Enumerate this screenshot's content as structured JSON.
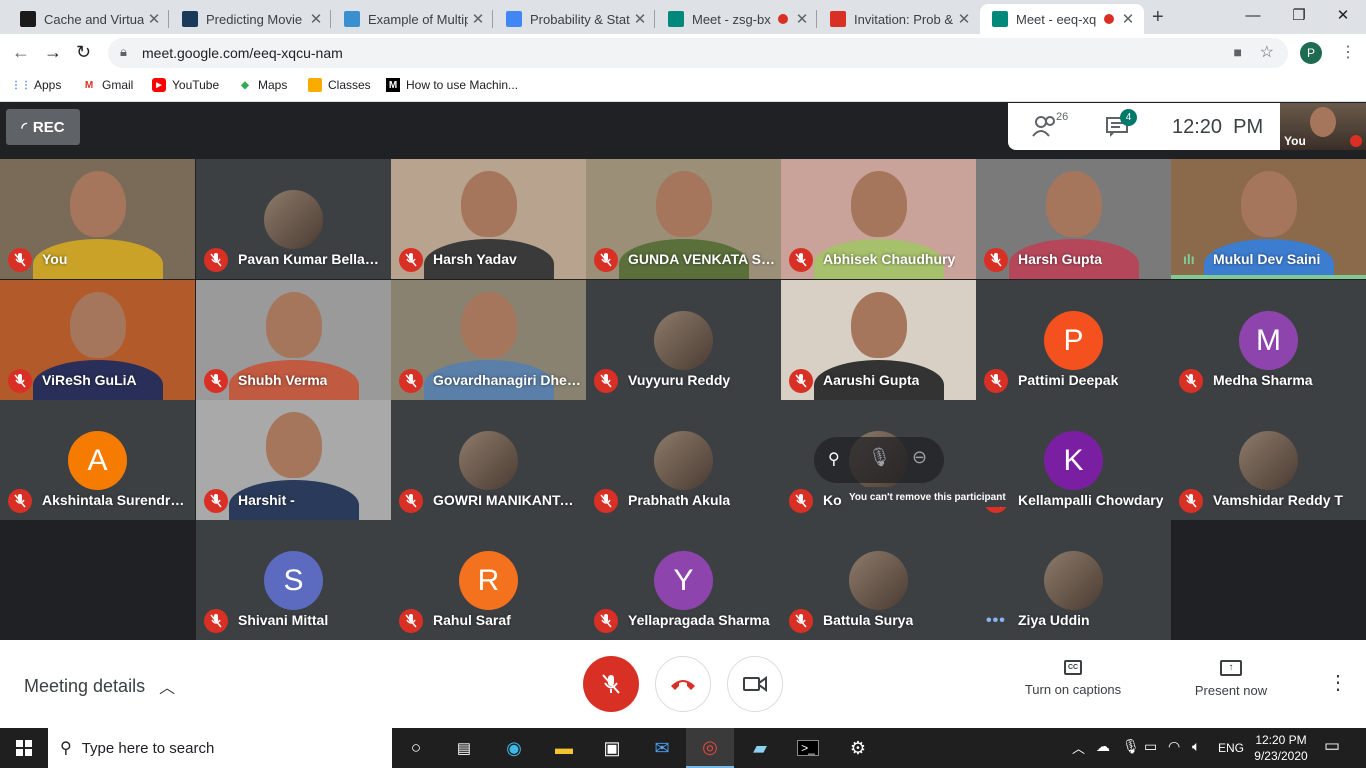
{
  "browser": {
    "tabs": [
      {
        "title": "Cache and Virtual",
        "icon": "doc-icon",
        "color": "#1a1a1a"
      },
      {
        "title": "Predicting Movie R",
        "icon": "tds-icon",
        "color": "#1a3a5c"
      },
      {
        "title": "Example of Multip",
        "icon": "fish-icon",
        "color": "#3a8fd1"
      },
      {
        "title": "Probability & Stati",
        "icon": "person-icon",
        "color": "#4285f4"
      },
      {
        "title": "Meet - zsg-bx",
        "icon": "meet-icon",
        "color": "#00897b"
      },
      {
        "title": "Invitation: Prob &",
        "icon": "gmail-icon",
        "color": "#d93025"
      },
      {
        "title": "Meet - eeq-xq",
        "icon": "meet-icon",
        "color": "#00897b"
      }
    ],
    "url": "meet.google.com/eeq-xqcu-nam",
    "profile_initial": "P",
    "bookmarks": [
      "Apps",
      "Gmail",
      "YouTube",
      "Maps",
      "Classes",
      "How to use Machin..."
    ]
  },
  "meet": {
    "rec_label": "REC",
    "participant_count": "26",
    "chat_badge": "4",
    "time": "12:20  PM",
    "self_label": "You",
    "tiles": [
      {
        "name": "You",
        "kind": "video",
        "bg": "#7a6a58",
        "shirt": "#c9a227"
      },
      {
        "name": "Pavan Kumar Bellamk...",
        "kind": "photo"
      },
      {
        "name": "Harsh Yadav",
        "kind": "video",
        "bg": "#b8a48e",
        "shirt": "#3a3a3a"
      },
      {
        "name": "GUNDA VENKATA SAI ...",
        "kind": "video",
        "bg": "#9c8f78",
        "shirt": "#5a6f3a"
      },
      {
        "name": "Abhisek Chaudhury",
        "kind": "video",
        "bg": "#c9a39a",
        "shirt": "#a7c06b"
      },
      {
        "name": "Harsh Gupta",
        "kind": "video",
        "bg": "#7a7a7a",
        "shirt": "#b5475b"
      },
      {
        "name": "Mukul Dev Saini",
        "kind": "video",
        "bg": "#8a6a4a",
        "shirt": "#3c7dd0",
        "speaking": true
      },
      {
        "name": "ViReSh GuLiA",
        "kind": "video",
        "bg": "#b35a2a",
        "shirt": "#2a2f5a"
      },
      {
        "name": "Shubh Verma",
        "kind": "video",
        "bg": "#9a9a9a",
        "shirt": "#c05a40"
      },
      {
        "name": "Govardhanagiri Dheeraj",
        "kind": "video",
        "bg": "#8a8270",
        "shirt": "#5a7fa8"
      },
      {
        "name": "Vuyyuru Reddy",
        "kind": "photo"
      },
      {
        "name": "Aarushi Gupta",
        "kind": "video",
        "bg": "#d8d0c4",
        "shirt": "#333333"
      },
      {
        "name": "Pattimi Deepak",
        "kind": "letter",
        "letter": "P",
        "color": "#f4511e"
      },
      {
        "name": "Medha Sharma",
        "kind": "letter",
        "letter": "M",
        "color": "#8e44ad"
      },
      {
        "name": "Akshintala Surendra ku...",
        "kind": "letter",
        "letter": "A",
        "color": "#f57c00"
      },
      {
        "name": "Harshit -",
        "kind": "video",
        "bg": "#a9a9a9",
        "shirt": "#2a3a5a"
      },
      {
        "name": "GOWRI MANIKANTA N...",
        "kind": "photo"
      },
      {
        "name": "Prabhath Akula",
        "kind": "photo"
      },
      {
        "name": "Kol",
        "kind": "photo",
        "hover": true
      },
      {
        "name": "Kellampalli Chowdary",
        "kind": "letter",
        "letter": "K",
        "color": "#7b1fa2"
      },
      {
        "name": "Vamshidar Reddy T",
        "kind": "photo"
      },
      {
        "name": "Shivani Mittal",
        "kind": "letter",
        "letter": "S",
        "color": "#5c6bc0"
      },
      {
        "name": "Rahul Saraf",
        "kind": "letter",
        "letter": "R",
        "color": "#f4711e"
      },
      {
        "name": "Yellapragada Sharma",
        "kind": "letter",
        "letter": "Y",
        "color": "#8e44ad"
      },
      {
        "name": "Battula Surya",
        "kind": "photo"
      },
      {
        "name": "Ziya Uddin",
        "kind": "photo",
        "dots": true
      }
    ],
    "tooltip": "You can't remove this participant",
    "meeting_details": "Meeting details",
    "captions_label": "Turn on captions",
    "present_label": "Present now"
  },
  "taskbar": {
    "search_placeholder": "Type here to search",
    "lang": "ENG",
    "time": "12:20 PM",
    "date": "9/23/2020"
  }
}
